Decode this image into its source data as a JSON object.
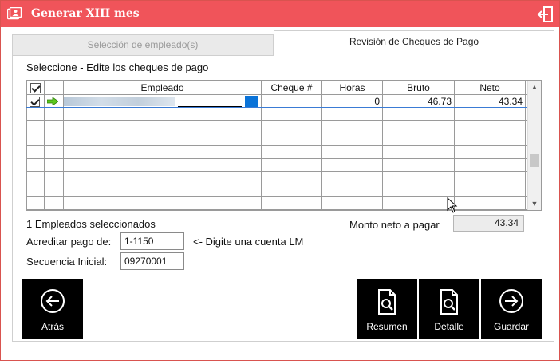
{
  "window": {
    "title": "Generar XIII mes"
  },
  "tabs": [
    {
      "label": "Selección de empleado(s)",
      "active": false
    },
    {
      "label": "Revisión de Cheques de Pago",
      "active": true
    }
  ],
  "section_label": "Seleccione - Edite los cheques de pago",
  "table": {
    "columns": [
      "Empleado",
      "Cheque #",
      "Horas",
      "Bruto",
      "Neto"
    ],
    "rows": [
      {
        "checked": true,
        "empleado": "",
        "cheque": "",
        "horas": "0",
        "bruto": "46.73",
        "neto": "43.34"
      }
    ]
  },
  "footer": {
    "selected_count": "1 Empleados seleccionados",
    "net_label": "Monto neto a pagar",
    "net_value": "43.34",
    "credit_label": "Acreditar pago de:",
    "credit_value": "1-1150",
    "credit_hint": "<- Digite una cuenta LM",
    "seq_label": "Secuencia Inicial:",
    "seq_value": "09270001"
  },
  "buttons": {
    "back": "Atrás",
    "summary": "Resumen",
    "detail": "Detalle",
    "save": "Guardar"
  },
  "colors": {
    "titlebar": "#f0545a",
    "button_bg": "#000000",
    "selection": "#0a73d8"
  },
  "icons": {
    "app": "app-icon",
    "exit": "exit-icon",
    "back": "arrow-left-circle-icon",
    "summary": "document-search-icon",
    "detail": "document-search-icon",
    "save": "arrow-right-circle-icon"
  }
}
